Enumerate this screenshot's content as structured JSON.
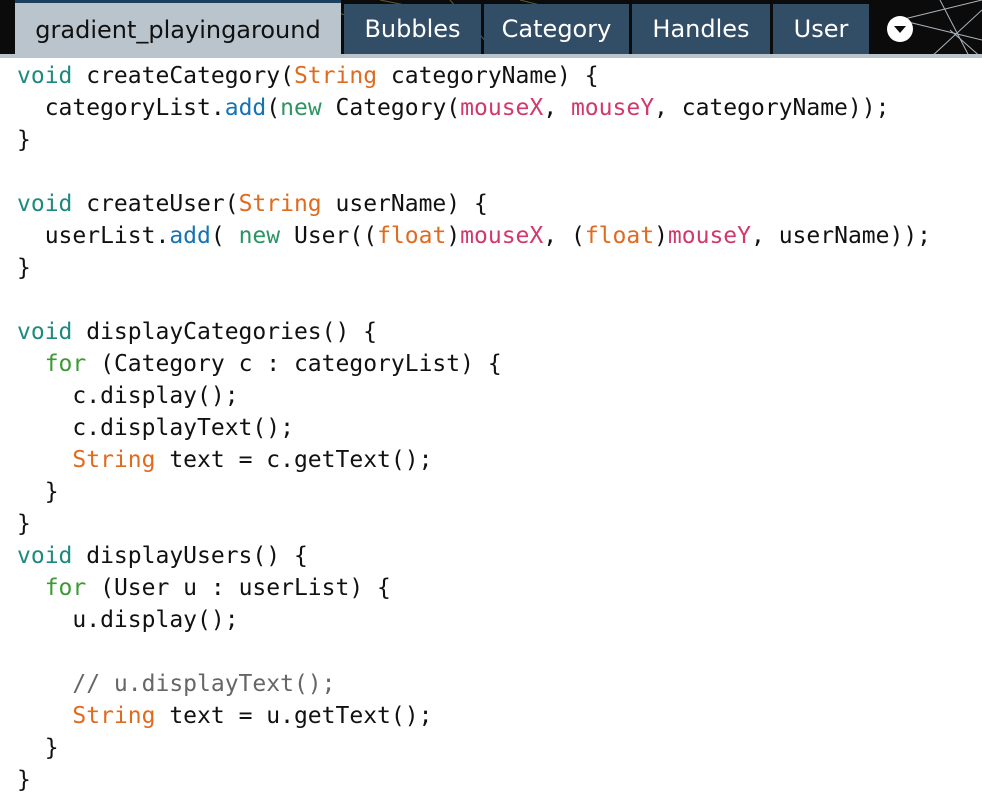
{
  "tabs": [
    {
      "label": "gradient_playingaround",
      "active": true
    },
    {
      "label": "Bubbles",
      "active": false
    },
    {
      "label": "Category",
      "active": false
    },
    {
      "label": "Handles",
      "active": false
    },
    {
      "label": "User",
      "active": false
    }
  ],
  "tab_menu_icon": "dropdown-arrow-icon",
  "colors": {
    "tabbar_bg": "#0b0b0b",
    "tab_inactive": "#324d66",
    "tab_active": "#b9c4cc",
    "keyword_void": "#1e8a7e",
    "keyword_type": "#e06b1f",
    "keyword_new": "#2d9463",
    "keyword_for": "#3b9a36",
    "builtin_fn": "#1473b5",
    "system_var": "#d1386e",
    "comment": "#666666"
  },
  "code_lines": [
    [
      [
        "void",
        "kw-void"
      ],
      [
        " createCategory(",
        "t"
      ],
      [
        "String",
        "kw-type"
      ],
      [
        " categoryName) {",
        "t"
      ]
    ],
    [
      [
        "  categoryList.",
        "t"
      ],
      [
        "add",
        "fn-builtin"
      ],
      [
        "(",
        "t"
      ],
      [
        "new",
        "kw-new"
      ],
      [
        " Category(",
        "t"
      ],
      [
        "mouseX",
        "var-sys"
      ],
      [
        ", ",
        "t"
      ],
      [
        "mouseY",
        "var-sys"
      ],
      [
        ", categoryName));",
        "t"
      ]
    ],
    [
      [
        "}",
        "t"
      ]
    ],
    [],
    [
      [
        "void",
        "kw-void"
      ],
      [
        " createUser(",
        "t"
      ],
      [
        "String",
        "kw-type"
      ],
      [
        " userName) {",
        "t"
      ]
    ],
    [
      [
        "  userList.",
        "t"
      ],
      [
        "add",
        "fn-builtin"
      ],
      [
        "( ",
        "t"
      ],
      [
        "new",
        "kw-new"
      ],
      [
        " User((",
        "t"
      ],
      [
        "float",
        "kw-type"
      ],
      [
        ")",
        "t"
      ],
      [
        "mouseX",
        "var-sys"
      ],
      [
        ", (",
        "t"
      ],
      [
        "float",
        "kw-type"
      ],
      [
        ")",
        "t"
      ],
      [
        "mouseY",
        "var-sys"
      ],
      [
        ", userName));",
        "t"
      ]
    ],
    [
      [
        "}",
        "t"
      ]
    ],
    [],
    [
      [
        "void",
        "kw-void"
      ],
      [
        " displayCategories() {",
        "t"
      ]
    ],
    [
      [
        "  ",
        "t"
      ],
      [
        "for",
        "kw-for"
      ],
      [
        " (Category c : categoryList) {",
        "t"
      ]
    ],
    [
      [
        "    c.display();",
        "t"
      ]
    ],
    [
      [
        "    c.displayText();",
        "t"
      ]
    ],
    [
      [
        "    ",
        "t"
      ],
      [
        "String",
        "kw-type"
      ],
      [
        " text = c.getText();",
        "t"
      ]
    ],
    [
      [
        "  }",
        "t"
      ]
    ],
    [
      [
        "}",
        "t"
      ]
    ],
    [
      [
        "void",
        "kw-void"
      ],
      [
        " displayUsers() {",
        "t"
      ]
    ],
    [
      [
        "  ",
        "t"
      ],
      [
        "for",
        "kw-for"
      ],
      [
        " (User u : userList) {",
        "t"
      ]
    ],
    [
      [
        "    u.display();",
        "t"
      ]
    ],
    [],
    [
      [
        "    ",
        "t"
      ],
      [
        "// u.displayText();",
        "comment"
      ]
    ],
    [
      [
        "    ",
        "t"
      ],
      [
        "String",
        "kw-type"
      ],
      [
        " text = u.getText();",
        "t"
      ]
    ],
    [
      [
        "  }",
        "t"
      ]
    ],
    [
      [
        "}",
        "t"
      ]
    ]
  ]
}
